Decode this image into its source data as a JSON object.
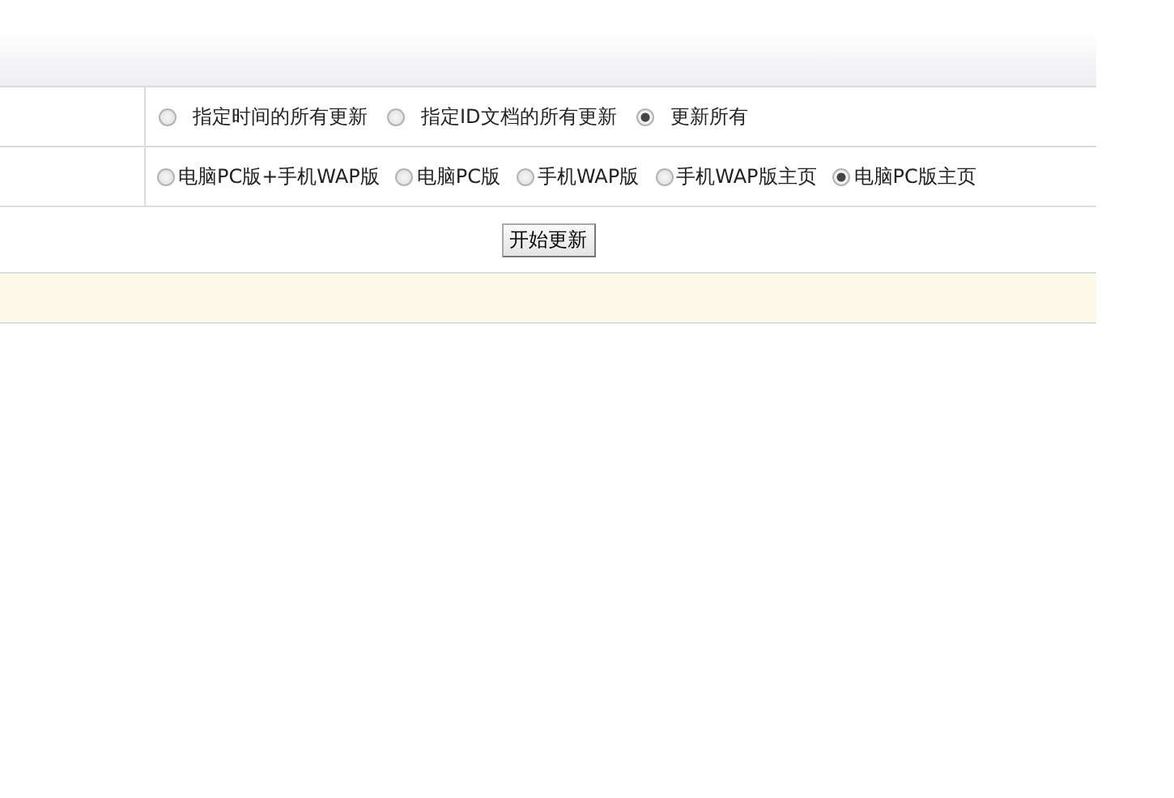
{
  "option_groups": [
    {
      "options": [
        {
          "label": "指定时间的所有更新",
          "selected": false
        },
        {
          "label": "指定ID文档的所有更新",
          "selected": false
        },
        {
          "label": "更新所有",
          "selected": true
        }
      ]
    },
    {
      "options": [
        {
          "label": "电脑PC版+手机WAP版",
          "selected": false
        },
        {
          "label": "电脑PC版",
          "selected": false
        },
        {
          "label": "手机WAP版",
          "selected": false
        },
        {
          "label": "手机WAP版主页",
          "selected": false
        },
        {
          "label": "电脑PC版主页",
          "selected": true
        }
      ]
    }
  ],
  "start_button": "开始更新"
}
